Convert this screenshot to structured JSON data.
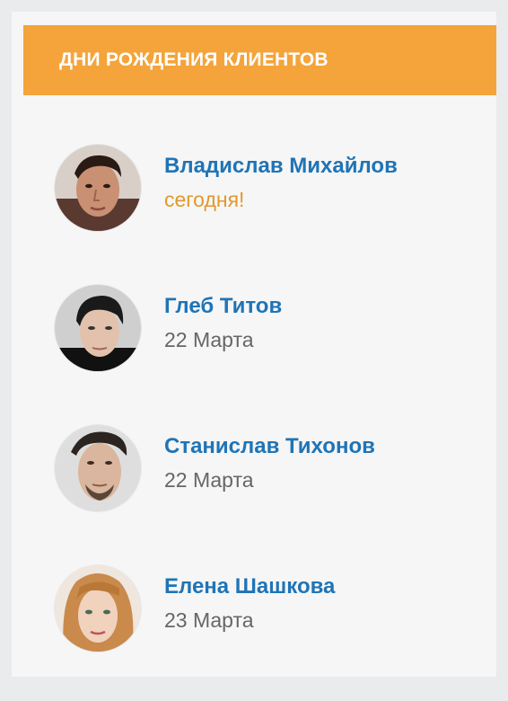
{
  "widget": {
    "title": "Дни рождения клиентов"
  },
  "clients": [
    {
      "name": "Владислав Михайлов",
      "date": "сегодня!",
      "is_today": true,
      "avatar_icon": "client-photo-icon"
    },
    {
      "name": "Глеб Титов",
      "date": "22 Марта",
      "is_today": false,
      "avatar_icon": "client-photo-icon"
    },
    {
      "name": "Станислав Тихонов",
      "date": "22 Марта",
      "is_today": false,
      "avatar_icon": "client-photo-icon"
    },
    {
      "name": "Елена Шашкова",
      "date": "23 Марта",
      "is_today": false,
      "avatar_icon": "client-photo-icon"
    }
  ],
  "colors": {
    "header_bg": "#f4a43a",
    "name": "#1f74b6",
    "today": "#e2982c",
    "date": "#666666",
    "panel_bg": "#f6f6f6",
    "page_bg": "#e9ebed"
  }
}
